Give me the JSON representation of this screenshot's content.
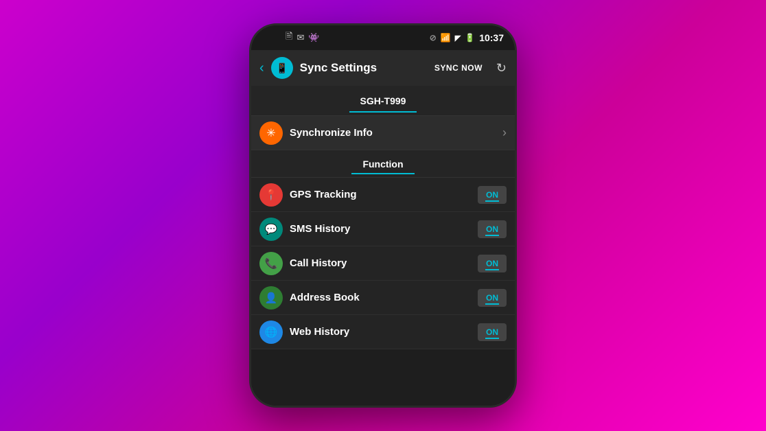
{
  "statusBar": {
    "time": "10:37",
    "leftIcons": [
      "📋",
      "📬",
      "👾"
    ],
    "rightIconNames": [
      "signal-off-icon",
      "wifi-icon",
      "network-icon",
      "battery-icon"
    ]
  },
  "header": {
    "backLabel": "‹",
    "iconSymbol": "📱",
    "title": "Sync Settings",
    "syncNowLabel": "SYNC NOW",
    "refreshIconLabel": "↻"
  },
  "deviceTab": {
    "label": "SGH-T999"
  },
  "synchronizeInfo": {
    "iconSymbol": "✳",
    "label": "Synchronize Info"
  },
  "functionTab": {
    "label": "Function"
  },
  "features": [
    {
      "id": "gps",
      "iconSymbol": "📍",
      "iconColor": "icon-red",
      "label": "GPS Tracking",
      "toggle": "ON"
    },
    {
      "id": "sms",
      "iconSymbol": "💬",
      "iconColor": "icon-teal",
      "label": "SMS History",
      "toggle": "ON"
    },
    {
      "id": "call",
      "iconSymbol": "📞",
      "iconColor": "icon-green",
      "label": "Call History",
      "toggle": "ON"
    },
    {
      "id": "address",
      "iconSymbol": "👤",
      "iconColor": "icon-green2",
      "label": "Address Book",
      "toggle": "ON"
    },
    {
      "id": "web",
      "iconSymbol": "🌐",
      "iconColor": "icon-blue",
      "label": "Web History",
      "toggle": "ON"
    }
  ]
}
